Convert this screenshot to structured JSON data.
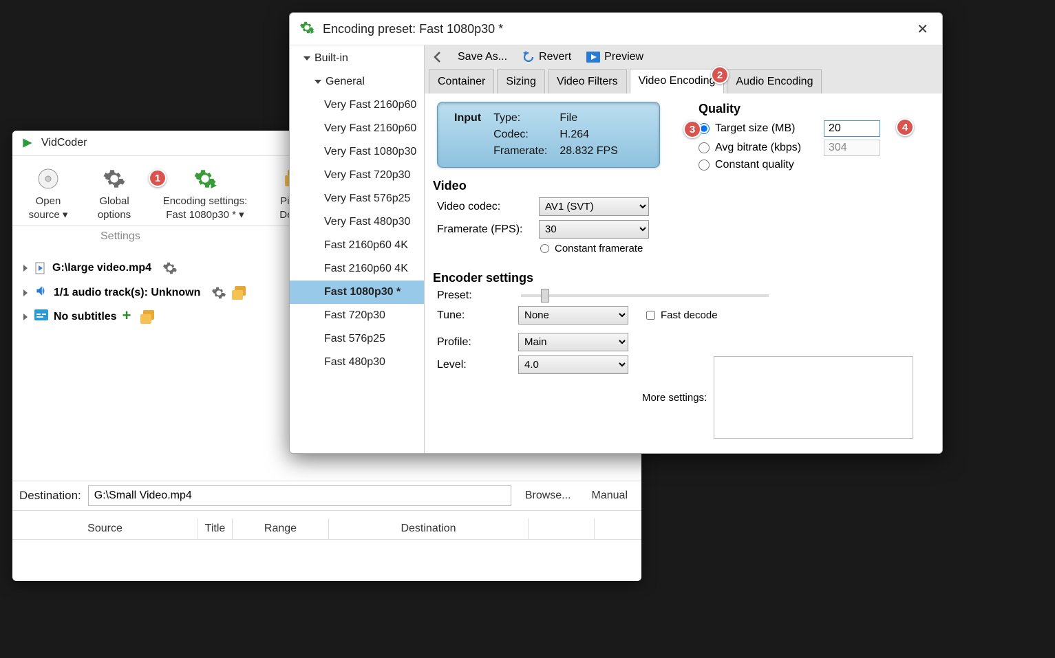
{
  "main": {
    "title": "VidCoder",
    "toolbar": {
      "open_source": "Open\nsource ▾",
      "global_options": "Global\noptions",
      "encoding_settings": "Encoding settings:\nFast 1080p30 * ▾",
      "picker_default": "Picker:\nDefault",
      "settings_caption": "Settings"
    },
    "source": {
      "file": "G:\\large video.mp4",
      "audio": "1/1 audio track(s): Unknown",
      "subs": "No subtitles"
    },
    "destination": {
      "label": "Destination:",
      "value": "G:\\Small Video.mp4",
      "browse": "Browse...",
      "manual": "Manual"
    },
    "queue_headers": [
      "Source",
      "Title",
      "Range",
      "Destination"
    ]
  },
  "preset": {
    "title": "Encoding preset: Fast 1080p30 *",
    "tree": {
      "root": "Built-in",
      "group": "General",
      "items": [
        "Very Fast 2160p60",
        "Very Fast 2160p60",
        "Very Fast 1080p30",
        "Very Fast 720p30",
        "Very Fast 576p25",
        "Very Fast 480p30",
        "Fast 2160p60 4K",
        "Fast 2160p60 4K",
        "Fast 1080p30 *",
        "Fast 720p30",
        "Fast 576p25",
        "Fast 480p30"
      ],
      "selected_index": 8
    },
    "toolbar": {
      "save_as": "Save As...",
      "revert": "Revert",
      "preview": "Preview"
    },
    "tabs": [
      "Container",
      "Sizing",
      "Video Filters",
      "Video Encoding",
      "Audio Encoding"
    ],
    "active_tab": 3,
    "input_info": {
      "head": "Input",
      "type_k": "Type:",
      "type_v": "File",
      "codec_k": "Codec:",
      "codec_v": "H.264",
      "fr_k": "Framerate:",
      "fr_v": "28.832 FPS"
    },
    "quality": {
      "title": "Quality",
      "target_size": "Target size (MB)",
      "target_size_val": "20",
      "avg_bitrate": "Avg bitrate (kbps)",
      "avg_bitrate_val": "304",
      "constant_quality": "Constant quality"
    },
    "video": {
      "title": "Video",
      "codec_label": "Video codec:",
      "codec_value": "AV1 (SVT)",
      "fr_label": "Framerate (FPS):",
      "fr_value": "30",
      "constant_fr": "Constant framerate"
    },
    "encoder": {
      "title": "Encoder settings",
      "preset_label": "Preset:",
      "tune_label": "Tune:",
      "tune_value": "None",
      "fast_decode": "Fast decode",
      "profile_label": "Profile:",
      "profile_value": "Main",
      "level_label": "Level:",
      "level_value": "4.0",
      "more_label": "More settings:"
    }
  },
  "badges": {
    "b1": "1",
    "b2": "2",
    "b3": "3",
    "b4": "4"
  }
}
